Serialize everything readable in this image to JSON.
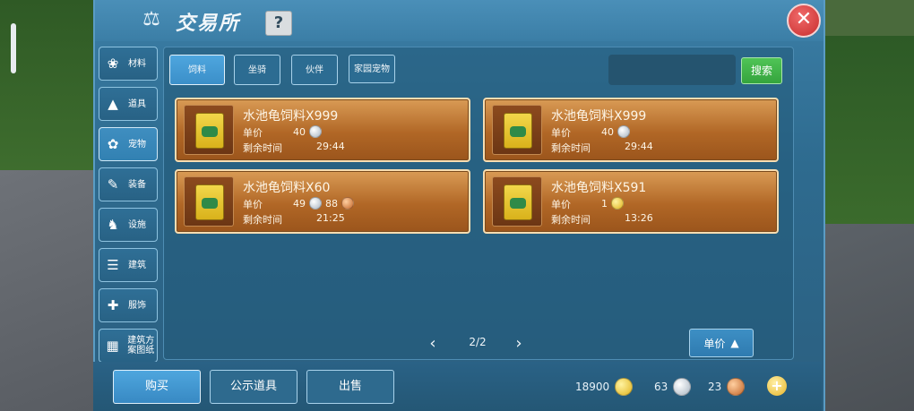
{
  "header": {
    "title": "交易所",
    "help_label": "?",
    "close_label": "✕"
  },
  "categories": [
    {
      "label": "材料",
      "icon": "material-icon",
      "active": false
    },
    {
      "label": "道具",
      "icon": "flask-icon",
      "active": false
    },
    {
      "label": "宠物",
      "icon": "paw-icon",
      "active": true
    },
    {
      "label": "装备",
      "icon": "armor-icon",
      "active": false
    },
    {
      "label": "设施",
      "icon": "horse-icon",
      "active": false
    },
    {
      "label": "建筑",
      "icon": "building-icon",
      "active": false
    },
    {
      "label": "服饰",
      "icon": "clothing-icon",
      "active": false
    },
    {
      "label": "建筑方案图纸",
      "icon": "blueprint-icon",
      "active": false
    }
  ],
  "tabs": [
    {
      "label": "饲料",
      "active": true
    },
    {
      "label": "坐骑",
      "active": false
    },
    {
      "label": "伙伴",
      "active": false
    },
    {
      "label": "家园宠物",
      "active": false
    }
  ],
  "search": {
    "button_label": "搜索",
    "placeholder": ""
  },
  "listings": [
    {
      "name": "水池龟饲料X999",
      "price_label": "单价",
      "price": [
        {
          "amount": "40",
          "coin": "silver"
        }
      ],
      "time_label": "剩余时间",
      "time": "29:44"
    },
    {
      "name": "水池龟饲料X999",
      "price_label": "单价",
      "price": [
        {
          "amount": "40",
          "coin": "silver"
        }
      ],
      "time_label": "剩余时间",
      "time": "29:44"
    },
    {
      "name": "水池龟饲料X60",
      "price_label": "单价",
      "price": [
        {
          "amount": "49",
          "coin": "silver"
        },
        {
          "amount": "88",
          "coin": "copper"
        }
      ],
      "time_label": "剩余时间",
      "time": "21:25"
    },
    {
      "name": "水池龟饲料X591",
      "price_label": "单价",
      "price": [
        {
          "amount": "1",
          "coin": "gold"
        }
      ],
      "time_label": "剩余时间",
      "time": "13:26"
    }
  ],
  "pager": {
    "text": "2/2",
    "prev": "‹",
    "next": "›"
  },
  "sort": {
    "label": "单价"
  },
  "bottom": {
    "buy_label": "购买",
    "public_label": "公示道具",
    "sell_label": "出售"
  },
  "currency": {
    "gold": "18900",
    "silver": "63",
    "copper": "23"
  },
  "colors": {
    "panel": "#3b7ea6",
    "card": "#b16726",
    "accent_green": "#35a43d",
    "close_red": "#c82d2d"
  }
}
